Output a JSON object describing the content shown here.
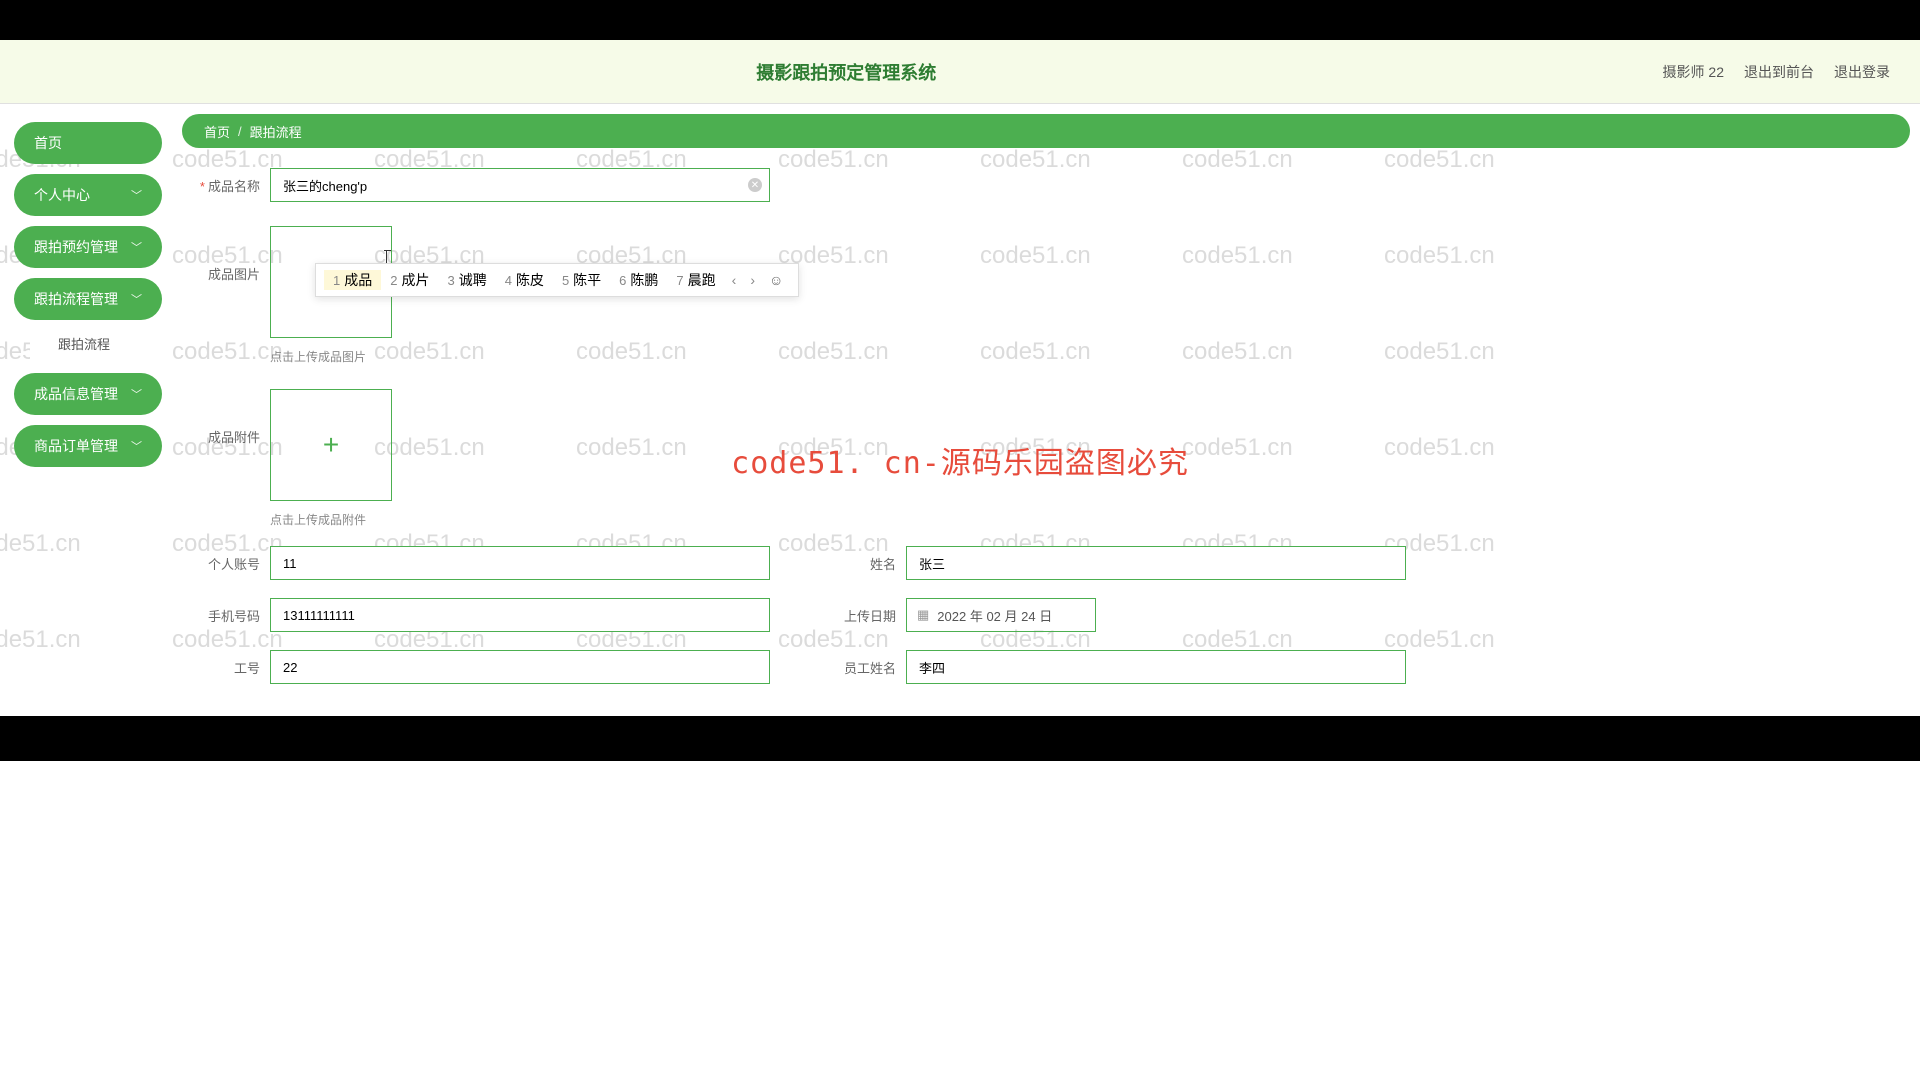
{
  "header": {
    "title": "摄影跟拍预定管理系统",
    "user": "摄影师 22",
    "logout_front": "退出到前台",
    "logout": "退出登录"
  },
  "sidebar": {
    "home": "首页",
    "personal": "个人中心",
    "reserve": "跟拍预约管理",
    "process": "跟拍流程管理",
    "process_sub": "跟拍流程",
    "product": "成品信息管理",
    "order": "商品订单管理"
  },
  "breadcrumb": {
    "home": "首页",
    "current": "跟拍流程"
  },
  "form": {
    "product_name_label": "成品名称",
    "product_name_value": "张三的cheng'p",
    "image_label": "成品图片",
    "image_hint": "点击上传成品图片",
    "attach_label": "成品附件",
    "attach_hint": "点击上传成品附件",
    "account_label": "个人账号",
    "account_value": "11",
    "name_label": "姓名",
    "name_value": "张三",
    "phone_label": "手机号码",
    "phone_value": "13111111111",
    "date_label": "上传日期",
    "date_value": "2022 年 02 月 24 日",
    "empno_label": "工号",
    "empno_value": "22",
    "empname_label": "员工姓名",
    "empname_value": "李四"
  },
  "ime": {
    "candidates": [
      {
        "n": "1",
        "t": "成品"
      },
      {
        "n": "2",
        "t": "成片"
      },
      {
        "n": "3",
        "t": "诚聘"
      },
      {
        "n": "4",
        "t": "陈皮"
      },
      {
        "n": "5",
        "t": "陈平"
      },
      {
        "n": "6",
        "t": "陈鹏"
      },
      {
        "n": "7",
        "t": "晨跑"
      }
    ]
  },
  "watermark_text": "code51.cn",
  "center_wm": "code51. cn-源码乐园盗图必究"
}
